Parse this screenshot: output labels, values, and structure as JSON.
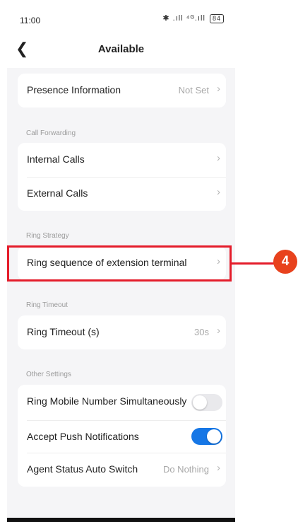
{
  "status_bar": {
    "time": "11:00",
    "icons_text": "✱ .ıll ⁴ᴳ.ıll",
    "battery": "84"
  },
  "header": {
    "title": "Available"
  },
  "presence": {
    "label": "Presence Information",
    "value": "Not Set"
  },
  "call_forwarding": {
    "section_label": "Call Forwarding",
    "internal_label": "Internal Calls",
    "external_label": "External Calls"
  },
  "ring_strategy": {
    "section_label": "Ring Strategy",
    "sequence_label": "Ring sequence of extension terminal"
  },
  "ring_timeout": {
    "section_label": "Ring Timeout",
    "label": "Ring Timeout (s)",
    "value": "30s"
  },
  "other_settings": {
    "section_label": "Other Settings",
    "ring_mobile_label": "Ring Mobile Number Simultaneously",
    "ring_mobile_enabled": false,
    "push_label": "Accept Push Notifications",
    "push_enabled": true,
    "agent_status_label": "Agent Status Auto Switch",
    "agent_status_value": "Do Nothing"
  },
  "callout": {
    "number": "4",
    "color": "#e41c2a"
  },
  "colors": {
    "toggle_on": "#1677e6",
    "background": "#f5f5f7"
  },
  "icons": {
    "back": "back-arrow-icon",
    "chevron": "chevron-right-icon"
  }
}
